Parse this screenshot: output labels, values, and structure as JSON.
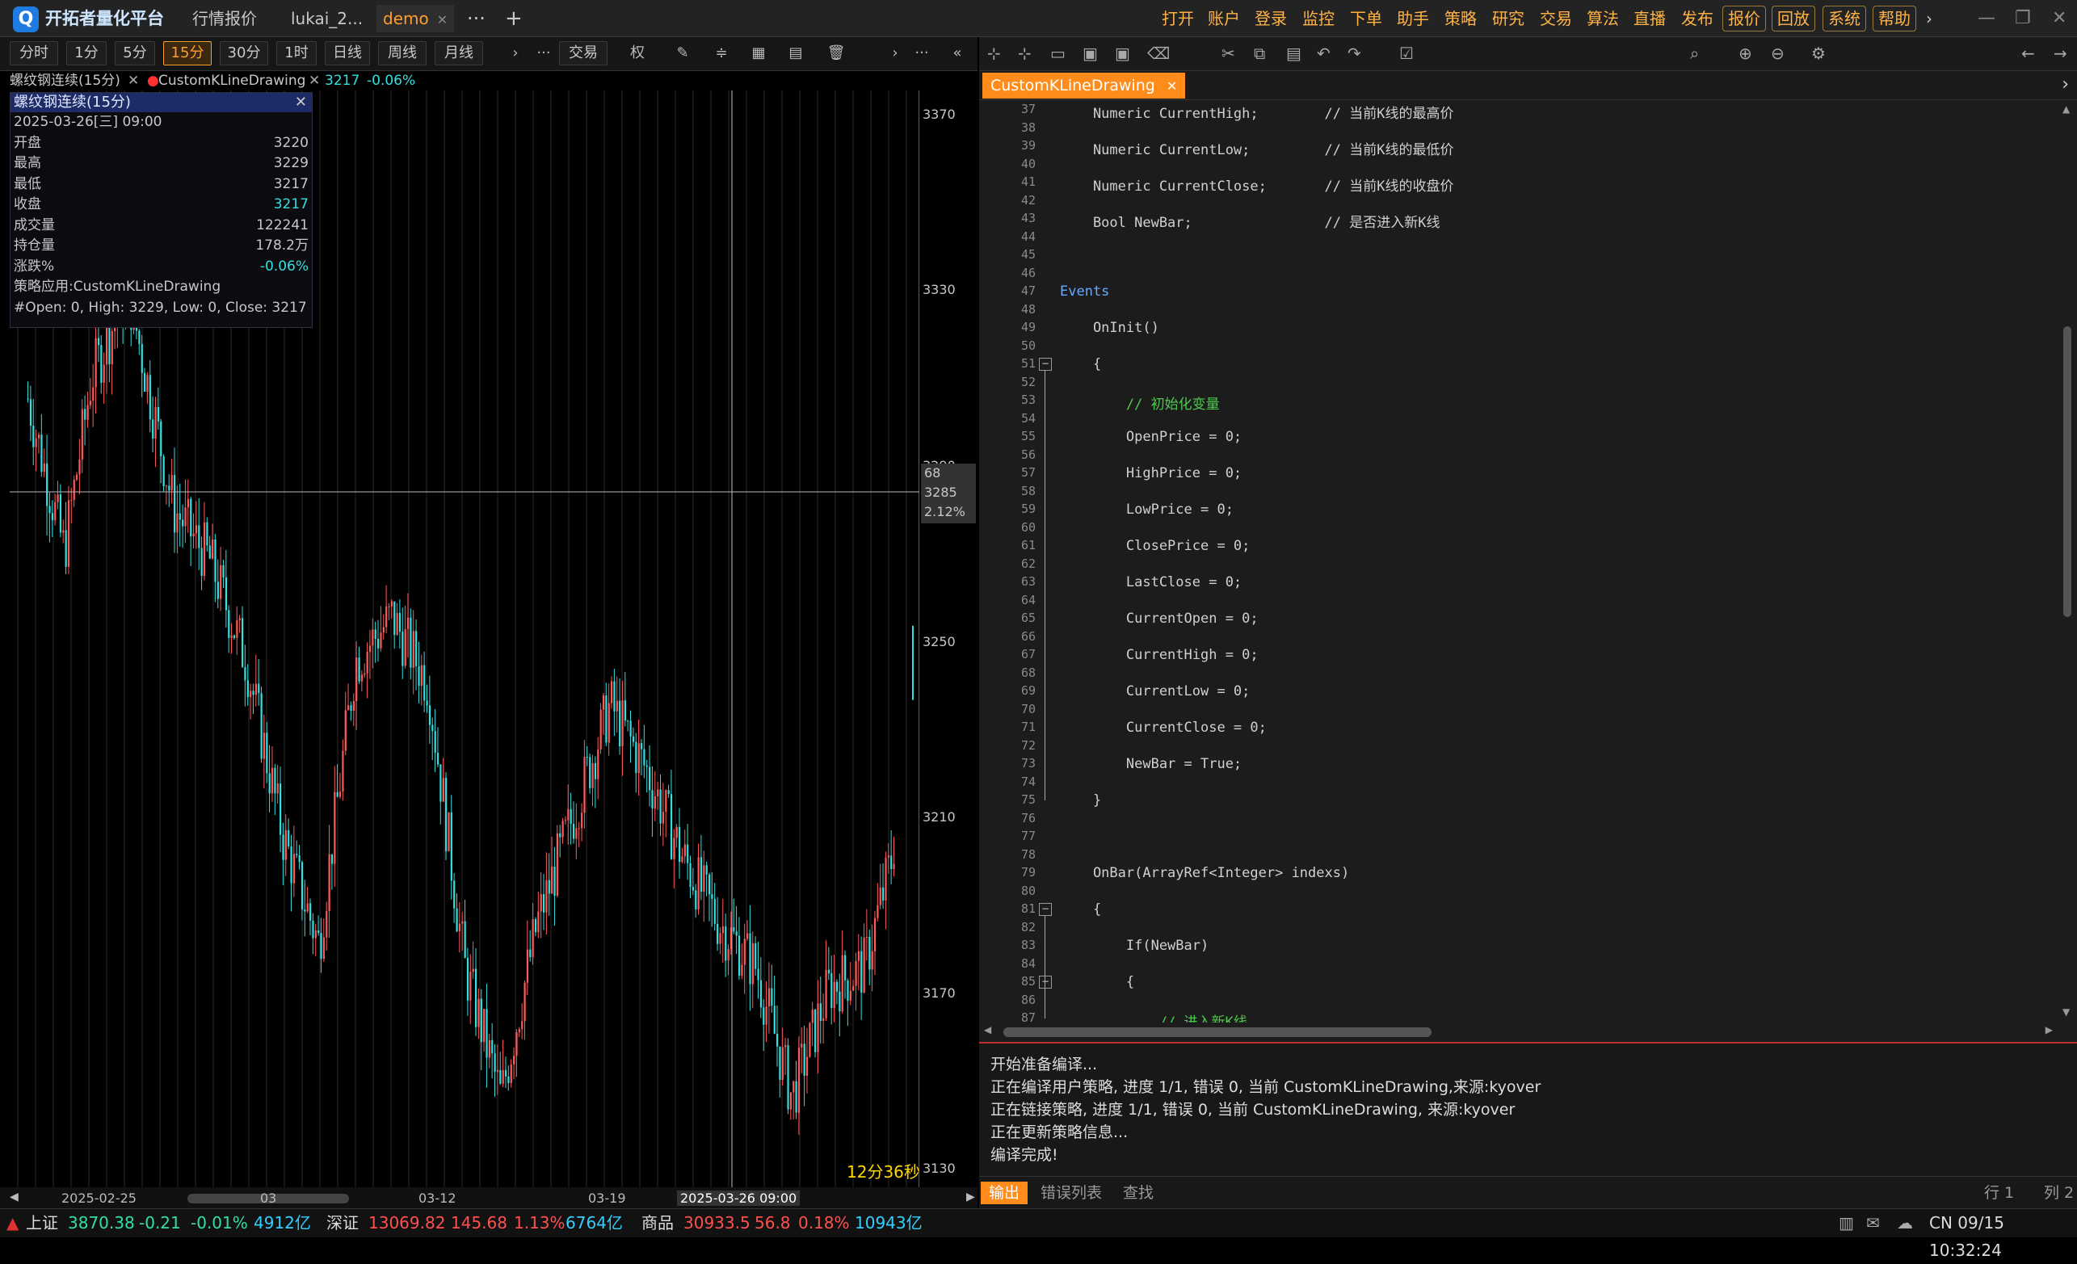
{
  "app": {
    "title": "开拓者量化平台"
  },
  "tabs": [
    {
      "label": "行情报价"
    },
    {
      "label": "lukai_2..."
    },
    {
      "label": "demo"
    }
  ],
  "top_menu": [
    "打开",
    "账户",
    "登录",
    "监控",
    "下单",
    "助手",
    "策略",
    "研究",
    "交易",
    "算法",
    "直播",
    "发布"
  ],
  "top_boxed": [
    "报价",
    "回放",
    "系统",
    "帮助"
  ],
  "periods": [
    "分时",
    "1分",
    "5分",
    "15分",
    "30分",
    "1时",
    "日线",
    "周线",
    "月线"
  ],
  "active_period": "15分",
  "toolbar": {
    "trade_label": "交易",
    "quan_label": "权"
  },
  "chart_header": {
    "symbol": "螺纹钢连续(15分)",
    "strategy": "CustomKLineDrawing",
    "price": "3217",
    "change": "-0.06%"
  },
  "info_panel": {
    "title": "螺纹钢连续(15分)",
    "datetime": "2025-03-26[三] 09:00",
    "rows": [
      {
        "label": "开盘",
        "value": "3220"
      },
      {
        "label": "最高",
        "value": "3229"
      },
      {
        "label": "最低",
        "value": "3217"
      },
      {
        "label": "收盘",
        "value": "3217"
      },
      {
        "label": "成交量",
        "value": "122241"
      },
      {
        "label": "持仓量",
        "value": "178.2万"
      },
      {
        "label": "涨跌%",
        "value": "-0.06%"
      }
    ],
    "strategy_line": "策略应用:CustomKLineDrawing",
    "ohlc_line": "#Open: 0, High: 3229, Low: 0, Close: 3217"
  },
  "chart": {
    "y_ticks": [
      "3370",
      "3330",
      "3290",
      "3250",
      "3210",
      "3170",
      "3130"
    ],
    "crosshair_labels": [
      "68",
      "3285",
      "2.12%"
    ],
    "x_ticks": [
      "2025-02-25",
      "03",
      "03-12",
      "03-19"
    ],
    "cursor_time": "2025-03-26 09:00",
    "countdown": "12分36秒",
    "up_color": "#ff5a5a",
    "down_color": "#33e0e0"
  },
  "chart_data": {
    "type": "candlestick",
    "title": "螺纹钢连续(15分)",
    "xlabel": "",
    "ylabel": "",
    "ylim": [
      3130,
      3370
    ],
    "path_x": [
      0.02,
      0.06,
      0.09,
      0.13,
      0.18,
      0.22,
      0.26,
      0.3,
      0.34,
      0.38,
      0.42,
      0.46,
      0.5,
      0.54,
      0.58,
      0.62,
      0.66,
      0.7,
      0.74,
      0.78,
      0.82,
      0.86,
      0.9,
      0.94,
      0.97,
      0.995
    ],
    "path_price": [
      3305,
      3270,
      3310,
      3330,
      3280,
      3268,
      3245,
      3205,
      3180,
      3245,
      3255,
      3240,
      3175,
      3145,
      3185,
      3210,
      3235,
      3220,
      3200,
      3185,
      3175,
      3145,
      3170,
      3175,
      3200,
      3245
    ]
  },
  "editor": {
    "toolbar_icons": [
      "new-file-icon",
      "new-class-icon",
      "open-folder-icon",
      "save-icon",
      "save-all-icon",
      "delete-icon",
      "cut-icon",
      "copy-icon",
      "paste-icon",
      "undo-icon",
      "redo-icon",
      "compile-icon",
      "search-icon",
      "zoom-in-icon",
      "zoom-out-icon",
      "settings-icon",
      "back-icon",
      "forward-icon"
    ],
    "tab": "CustomKLineDrawing",
    "line_numbers": [
      37,
      38,
      39,
      40,
      41,
      42,
      43,
      44,
      45,
      46,
      47,
      48,
      49,
      50,
      51,
      52,
      53,
      54,
      55,
      56,
      57,
      58,
      59,
      60,
      61,
      62,
      63,
      64,
      65,
      66,
      67,
      68,
      69,
      70,
      71,
      72,
      73,
      74,
      75,
      76,
      77,
      78,
      79,
      80,
      81,
      82,
      83,
      84,
      85,
      86,
      87
    ],
    "code_lines": [
      "    Numeric CurrentHigh;        // 当前K线的最高价",
      "",
      "    Numeric CurrentLow;         // 当前K线的最低价",
      "",
      "    Numeric CurrentClose;       // 当前K线的收盘价",
      "",
      "    Bool NewBar;                // 是否进入新K线",
      "",
      "",
      "",
      "Events",
      "",
      "    OnInit()",
      "",
      "    {",
      "",
      "        // 初始化变量",
      "",
      "        OpenPrice = 0;",
      "",
      "        HighPrice = 0;",
      "",
      "        LowPrice = 0;",
      "",
      "        ClosePrice = 0;",
      "",
      "        LastClose = 0;",
      "",
      "        CurrentOpen = 0;",
      "",
      "        CurrentHigh = 0;",
      "",
      "        CurrentLow = 0;",
      "",
      "        CurrentClose = 0;",
      "",
      "        NewBar = True;",
      "",
      "    }",
      "",
      "",
      "",
      "    OnBar(ArrayRef<Integer> indexs)",
      "",
      "    {",
      "",
      "        If(NewBar)",
      "",
      "        {",
      "",
      "            // 进入新K线"
    ]
  },
  "output": {
    "lines": [
      "开始准备编译...",
      "正在编译用户策略, 进度 1/1, 错误 0, 当前 CustomKLineDrawing,来源:kyover",
      "正在链接策略, 进度 1/1, 错误 0, 当前 CustomKLineDrawing, 来源:kyover",
      "正在更新策略信息...",
      "编译完成!"
    ],
    "tabs": [
      "输出",
      "错误列表",
      "查找"
    ],
    "cursor_row": "行 1",
    "cursor_col": "列 2"
  },
  "statusbar": {
    "sh": {
      "name": "上证",
      "price": "3870.38",
      "chg": "-0.21",
      "pct": "-0.01%",
      "amount": "4912亿"
    },
    "sz": {
      "name": "深证",
      "price": "13069.82",
      "chg": "145.68",
      "pct": "1.13%",
      "amount": "6764亿"
    },
    "cm": {
      "name": "商品",
      "price": "30933.5",
      "chg": "56.8",
      "pct": "0.18%",
      "amount": "10943亿"
    },
    "clock": "CN 09/15 10:32:24"
  }
}
